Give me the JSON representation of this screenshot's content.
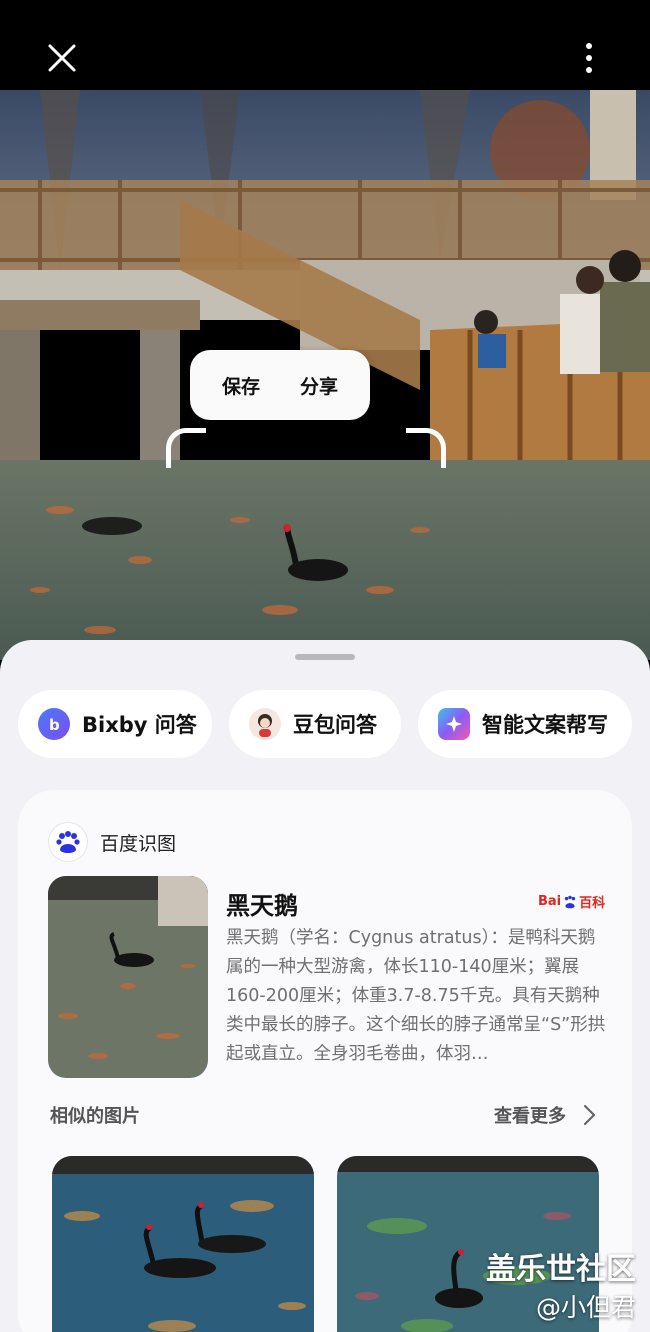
{
  "toolbar": {
    "close_icon": "close-icon",
    "more_icon": "more-vertical-icon"
  },
  "context_menu": {
    "save_label": "保存",
    "share_label": "分享"
  },
  "chips": [
    {
      "label": "Bixby 问答",
      "icon": "bixby-icon",
      "color": "#2d6cf0"
    },
    {
      "label": "豆包问答",
      "icon": "doubao-avatar-icon",
      "color": "#e84a4a"
    },
    {
      "label": "智能文案帮写",
      "icon": "ai-writing-icon",
      "color": "#6b5cf5"
    }
  ],
  "result_card": {
    "source_label": "百度识图",
    "source_icon": "baidu-paw-icon",
    "title": "黑天鹅",
    "baike_label_1": "Bai",
    "baike_label_2": "du",
    "baike_label_3": "百科",
    "description": "黑天鹅（学名：Cygnus atratus）：是鸭科天鹅属的一种大型游禽，体长110-140厘米；翼展160-200厘米；体重3.7-8.75千克。具有天鹅种类中最长的脖子。这个细长的脖子通常呈“S”形拱起或直立。全身羽毛卷曲，体羽…",
    "similar_title": "相似的图片",
    "see_more_label": "查看更多"
  },
  "watermark": {
    "main": "盖乐世社区",
    "sub": "@小但君"
  },
  "colors": {
    "sheet_bg": "#f2f2f6",
    "card_bg": "#fafafc",
    "baidu_blue": "#2932e1",
    "baike_red": "#e1261c"
  }
}
